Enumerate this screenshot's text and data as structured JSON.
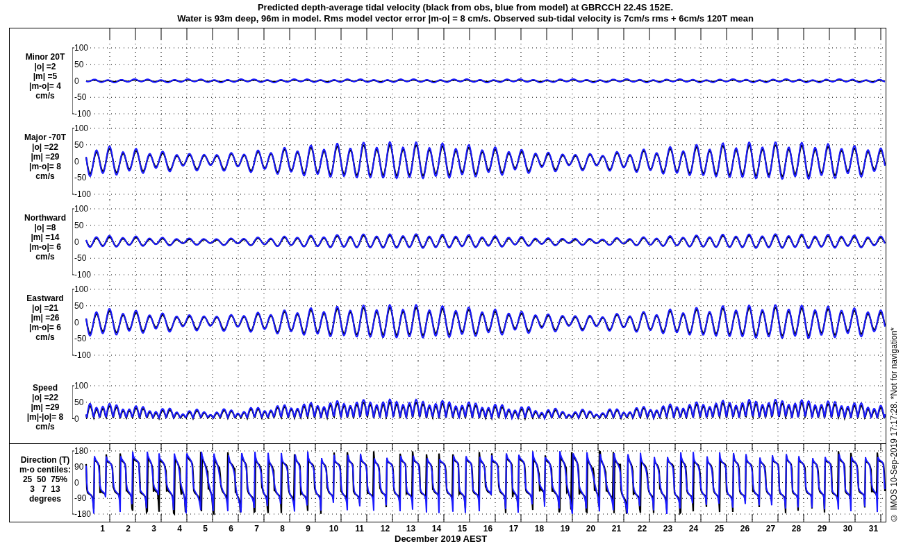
{
  "title_lines": [
    "Predicted depth-average tidal velocity (black from obs, blue from model) at GBRCCH 22.4S 152E.",
    "Water is 93m deep, 96m in model. Rms model vector error |m-o| = 8 cm/s. Observed sub-tidal velocity is 7cm/s rms + 6cm/s 120T mean"
  ],
  "panels": [
    {
      "kind": "minor",
      "label_lines": [
        "Minor 20T",
        "|o| =2",
        "|m| =5",
        "|m-o|= 4",
        "cm/s"
      ],
      "ticks": [
        "100",
        "50",
        "0",
        "-50",
        "-100"
      ]
    },
    {
      "kind": "major",
      "label_lines": [
        "Major -70T",
        "|o| =22",
        "|m| =29",
        "|m-o|= 8",
        "cm/s"
      ],
      "ticks": [
        "100",
        "50",
        "0",
        "-50",
        "-100"
      ]
    },
    {
      "kind": "northward",
      "label_lines": [
        "Northward",
        "|o| =8",
        "|m| =14",
        "|m-o|= 6",
        "cm/s"
      ],
      "ticks": [
        "100",
        "50",
        "0",
        "-50",
        "-100"
      ]
    },
    {
      "kind": "eastward",
      "label_lines": [
        "Eastward",
        "|o| =21",
        "|m| =26",
        "|m-o|= 6",
        "cm/s"
      ],
      "ticks": [
        "100",
        "50",
        "0",
        "-50",
        "-100"
      ]
    },
    {
      "kind": "speed",
      "label_lines": [
        "Speed",
        "|o| =22",
        "|m| =29",
        "|m|-|o|= 8",
        "cm/s"
      ],
      "ticks": [
        "100",
        "50",
        "0"
      ]
    },
    {
      "kind": "direction",
      "label_lines": [
        "Direction (T)",
        "m-o centiles:",
        "25  50  75%",
        "3   7  13",
        "degrees"
      ],
      "ticks": [
        "180",
        "90",
        "0",
        "-90",
        "-180"
      ]
    }
  ],
  "days": [
    "1",
    "2",
    "3",
    "4",
    "5",
    "6",
    "7",
    "8",
    "9",
    "10",
    "11",
    "12",
    "13",
    "14",
    "15",
    "16",
    "17",
    "18",
    "19",
    "20",
    "21",
    "22",
    "23",
    "24",
    "25",
    "26",
    "27",
    "28",
    "29",
    "30",
    "31"
  ],
  "xlabel": "December 2019 AEST",
  "credit": "© IMOS 10-Sep-2019 17:17:28. *Not for navigation*"
}
